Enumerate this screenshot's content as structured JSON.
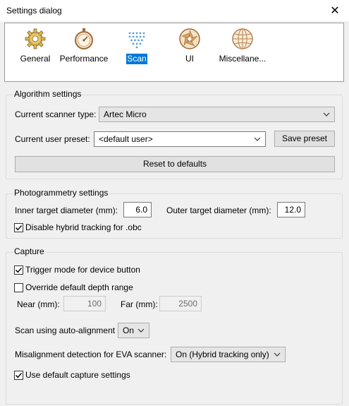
{
  "window": {
    "title": "Settings dialog",
    "close_glyph": "✕"
  },
  "nav": {
    "items": [
      {
        "label": "General",
        "icon": "gear-icon",
        "selected": false
      },
      {
        "label": "Performance",
        "icon": "stopwatch-icon",
        "selected": false
      },
      {
        "label": "Scan",
        "icon": "scan-dots-icon",
        "selected": true
      },
      {
        "label": "UI",
        "icon": "aperture-icon",
        "selected": false
      },
      {
        "label": "Miscellane...",
        "icon": "globe-icon",
        "selected": false
      }
    ]
  },
  "algorithm": {
    "title": "Algorithm settings",
    "scanner_type_label": "Current scanner type:",
    "scanner_type_value": "Artec Micro",
    "user_preset_label": "Current user preset:",
    "user_preset_value": "<default user>",
    "save_preset_label": "Save preset",
    "reset_label": "Reset to defaults"
  },
  "photogrammetry": {
    "title": "Photogrammetry settings",
    "inner_label": "Inner target diameter (mm):",
    "inner_value": "6.0",
    "outer_label": "Outer target diameter (mm):",
    "outer_value": "12.0",
    "disable_hybrid_label": "Disable hybrid tracking for .obc",
    "disable_hybrid_checked": true
  },
  "capture": {
    "title": "Capture",
    "trigger_label": "Trigger mode for device button",
    "trigger_checked": true,
    "override_label": "Override default depth range",
    "override_checked": false,
    "near_label": "Near (mm):",
    "near_value": "100",
    "far_label": "Far (mm):",
    "far_value": "2500",
    "auto_align_label": "Scan using auto-alignment",
    "auto_align_value": "On",
    "misalign_label": "Misalignment detection for EVA scanner:",
    "misalign_value": "On (Hybrid tracking only)",
    "default_capture_label": "Use default capture settings",
    "default_capture_checked": true
  }
}
